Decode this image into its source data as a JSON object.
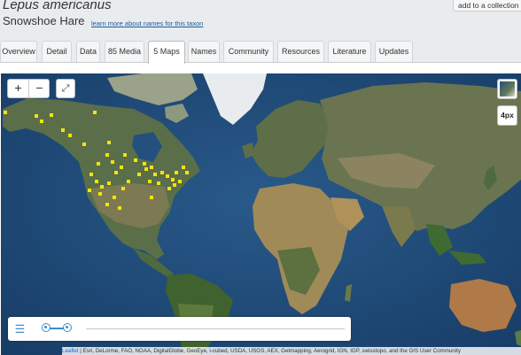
{
  "taxon": {
    "scientific_name": "Lepus americanus",
    "common_name": "Snowshoe Hare",
    "names_link": "learn more about names for this taxon"
  },
  "actions": {
    "add_to_collection": "add to a collection"
  },
  "tabs": [
    {
      "label": "Overview"
    },
    {
      "label": "Detail"
    },
    {
      "label": "Data"
    },
    {
      "label": "85 Media"
    },
    {
      "label": "5 Maps",
      "active": true
    },
    {
      "label": "Names"
    },
    {
      "label": "Community"
    },
    {
      "label": "Resources"
    },
    {
      "label": "Literature"
    },
    {
      "label": "Updates"
    }
  ],
  "map": {
    "zoom_in": "+",
    "zoom_out": "−",
    "fullscreen_icon": "expand-icon",
    "layer_icon": "satellite-layer-icon",
    "point_size_label": "4px",
    "legend_icon": "menu-icon",
    "occurrence_color": "#f5e40a",
    "ocean_color": "#1e4a78",
    "attribution_link": "Leaflet",
    "attribution_text": " | Esri, DeLorme, FAO, NOAA, DigitalGlobe, GeoEye, i-cubed, USDA, USGS, AEX, Getmapping, Aerogrid, IGN, IGP, swisstopo, and the GIS User Community"
  }
}
